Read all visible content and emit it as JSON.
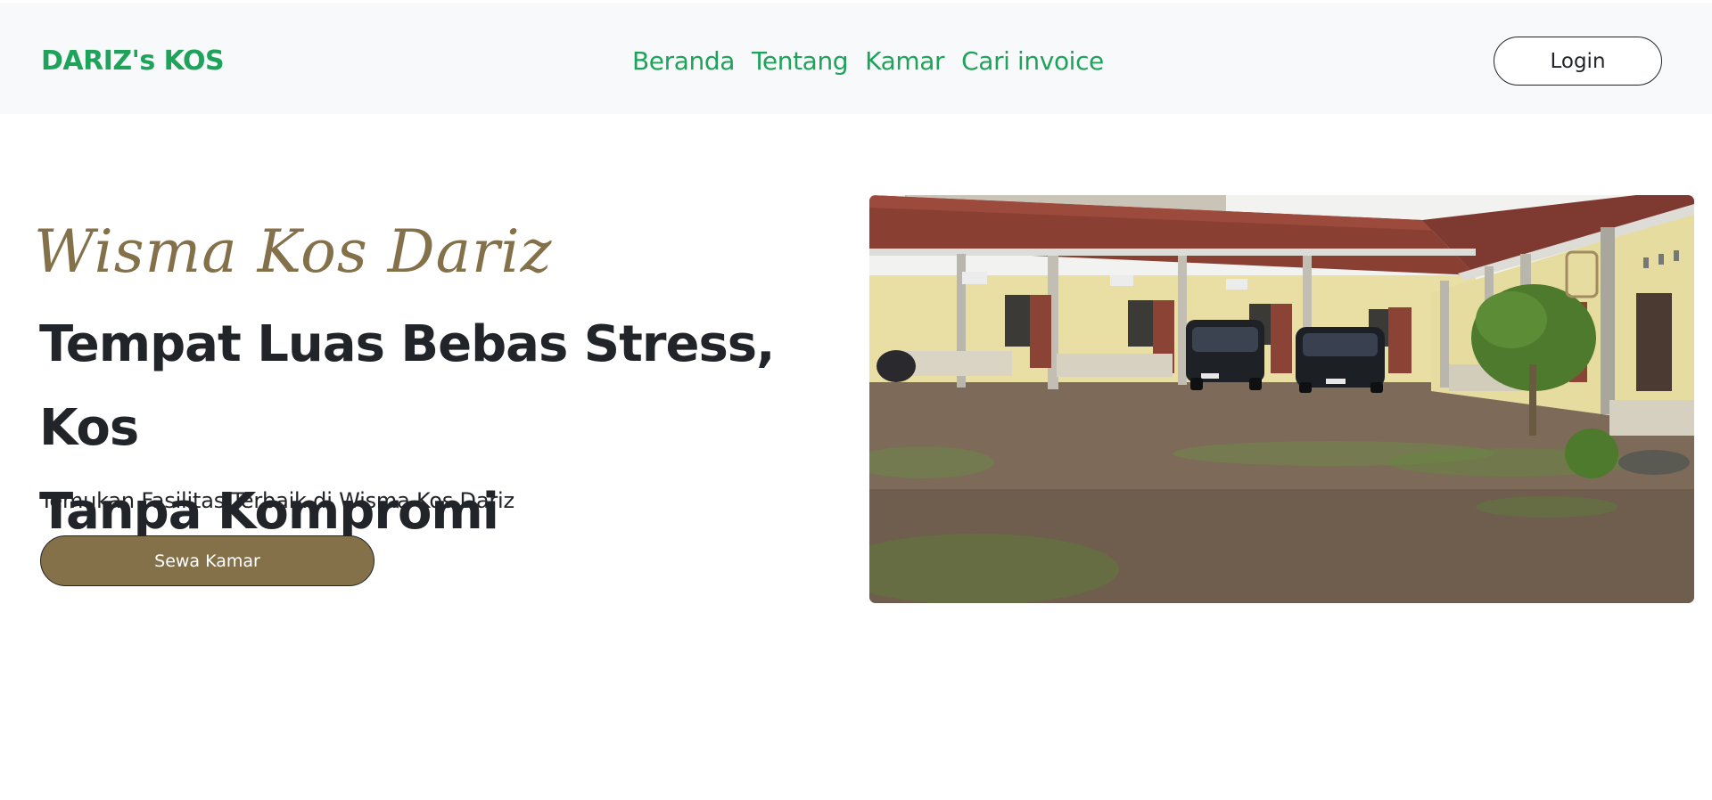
{
  "colors": {
    "brand_green": "#1ea35a",
    "accent_brown": "#84714a",
    "text_dark": "#212529",
    "navbar_bg": "#f8f9fa"
  },
  "navbar": {
    "brand": "DARIZ's KOS",
    "links": [
      "Beranda",
      "Tentang",
      "Kamar",
      "Cari invoice"
    ],
    "login_label": "Login"
  },
  "hero": {
    "script_title": "Wisma Kos Dariz",
    "headline_line1": "Tempat Luas Bebas Stress, Kos",
    "headline_line2": "Tanpa Kompromi",
    "subtext": "Temukan Fasilitas Terbaik di Wisma Kos Dariz",
    "cta_label": "Sewa Kamar"
  }
}
